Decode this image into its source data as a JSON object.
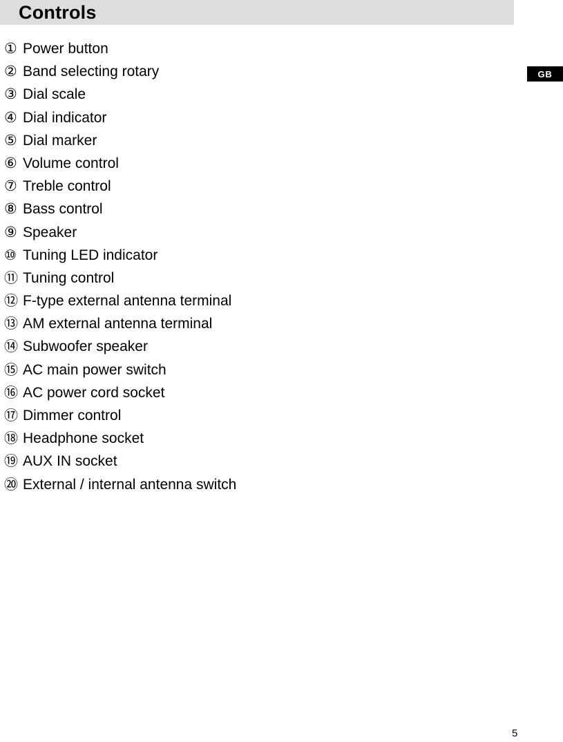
{
  "page": {
    "title": "Controls",
    "number": "5",
    "region_badge": "GB"
  },
  "controls": {
    "heading": "Controls",
    "items": [
      {
        "marker": "①",
        "number": "1",
        "label": "Power button"
      },
      {
        "marker": "②",
        "number": "2",
        "label": "Band selecting rotary"
      },
      {
        "marker": "③",
        "number": "3",
        "label": "Dial scale"
      },
      {
        "marker": "④",
        "number": "4",
        "label": "Dial indicator"
      },
      {
        "marker": "⑤",
        "number": "5",
        "label": "Dial marker"
      },
      {
        "marker": "⑥",
        "number": "6",
        "label": "Volume control"
      },
      {
        "marker": "⑦",
        "number": "7",
        "label": "Treble control"
      },
      {
        "marker": "⑧",
        "number": "8",
        "label": "Bass control"
      },
      {
        "marker": "⑨",
        "number": "9",
        "label": "Speaker"
      },
      {
        "marker": "⑩",
        "number": "10",
        "label": "Tuning LED indicator"
      },
      {
        "marker": "⑪",
        "number": "11",
        "label": "Tuning control"
      },
      {
        "marker": "⑫",
        "number": "12",
        "label": "F-type external antenna terminal"
      },
      {
        "marker": "⑬",
        "number": "13",
        "label": "AM external antenna terminal"
      },
      {
        "marker": "⑭",
        "number": "14",
        "label": "Subwoofer speaker"
      },
      {
        "marker": "⑮",
        "number": "15",
        "label": "AC main power switch"
      },
      {
        "marker": "⑯",
        "number": "16",
        "label": "AC power cord socket"
      },
      {
        "marker": "⑰",
        "number": "17",
        "label": "Dimmer control"
      },
      {
        "marker": "⑱",
        "number": "18",
        "label": "Headphone socket"
      },
      {
        "marker": "⑲",
        "number": "19",
        "label": "AUX IN socket"
      },
      {
        "marker": "⑳",
        "number": "20",
        "label": "External / internal antenna switch"
      }
    ]
  },
  "colors": {
    "header_background": "#dcdddf",
    "badge_background": "#000000",
    "badge_text": "#ffffff",
    "text": "#000000",
    "page_background": "#ffffff"
  }
}
